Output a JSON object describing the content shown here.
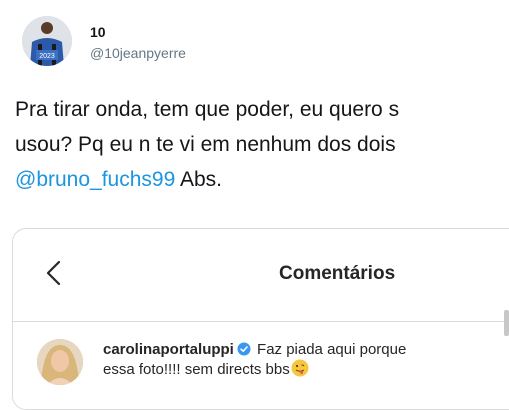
{
  "tweet": {
    "name": "10",
    "handle": "@10jeanpyerre",
    "line1": "Pra tirar onda, tem que poder, eu quero s",
    "line2": "usou? Pq eu n te vi em nenhum dos dois",
    "mention": "@bruno_fuchs99",
    "line3_rest": " Abs.",
    "avatar_jersey_text": "2023"
  },
  "instagram": {
    "title": "Comentários",
    "comment": {
      "username": "carolinaportaluppi",
      "text_line1": " Faz piada aqui porque",
      "text_line2": "essa foto!!!! sem directs bbs"
    }
  },
  "colors": {
    "mention": "#1b95e0",
    "verified": "#3897f0",
    "emoji": "#f7c640"
  },
  "icons": [
    "back-chevron-icon",
    "verified-badge-icon",
    "tongue-emoji-icon"
  ]
}
